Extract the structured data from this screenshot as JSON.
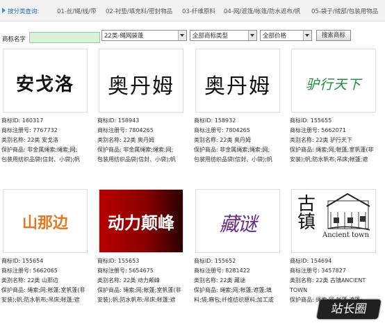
{
  "category_bar": {
    "title": "按分类查询:",
    "categories": [
      "01-丝/绳/线/带",
      "02-衬垫/填充料/密封物品",
      "03-纤维原料",
      "04-网/遮篷/帐篷/防水遮布/帆",
      "05-袋子/绒部/包装用物品"
    ]
  },
  "search": {
    "label": "商标名字",
    "name_value": "",
    "class_select": "22类-绳网袋蓬",
    "type_select": "全部商标类型",
    "price_select": "全部价格",
    "button": "搜索商标"
  },
  "cards": [
    {
      "logo": "安戈洛",
      "id": "商标ID: 160317",
      "reg": "商标注册号: 7767732",
      "cls": "类别名称: 22类   安戈洛",
      "goods": "保护商品: 非金属绳索;绳索;网;",
      "goods2": "包装用纺织品袋(信封、小袋);帆"
    },
    {
      "logo": "奥丹姆",
      "id": "商标ID: 158943",
      "reg": "商标注册号: 7804265",
      "cls": "类别名称: 22类   奥丹姆",
      "goods": "保护商品: 非金属绳索;绳索;网;",
      "goods2": "包装用纺织品袋(信封、小袋);帆"
    },
    {
      "logo": "奥丹姆",
      "id": "商标ID: 158932",
      "reg": "商标注册号: 7804265",
      "cls": "类别名称: 22类   奥丹姆",
      "goods": "保护商品: 非金属绳索;绳索;网;",
      "goods2": "包装用纺织品袋(信封、小袋);帆"
    },
    {
      "logo": "驴行天下",
      "id": "商标ID: 155655",
      "reg": "商标注册号: 5662071",
      "cls": "类别名称: 22类   驴行天下",
      "goods": "保护商品: 绳索;网;帐篷;室帆蓬(非",
      "goods2": "安装);帆;防水帆布;吊床;帐篷;遮"
    },
    {
      "logo": "山那边",
      "id": "商标ID: 155654",
      "reg": "商标注册号: 5662065",
      "cls": "类别名称: 22类   山那边",
      "goods": "保护商品: 绳索;网;帐篷;室帆蓬(非",
      "goods2": "安装);帆;防水帆布;吊床;帐篷;遮"
    },
    {
      "logo": "动力颠峰",
      "id": "商标ID: 155653",
      "reg": "商标注册号: 5654675",
      "cls": "类别名称: 22类   动力颠峰",
      "goods": "保护商品: 绳索;网;帐篷;室帆蓬(非",
      "goods2": "安装);帆;防水帆布;吊床;帐篷;遮"
    },
    {
      "logo": "藏谜",
      "id": "商标ID: 155652",
      "reg": "商标注册号: 8281422",
      "cls": "类别名称: 22类   藏谜",
      "goods": "保护商品: 绳索;网;帐篷;遮篷;填",
      "goods2": "料;袋;麻包;纤维纺织原料;加工或"
    },
    {
      "logo": "古镇",
      "logo_sub": "Ancient town",
      "id": "商标ID: 154694",
      "reg": "商标注册号: 3457827",
      "cls": "类别名称: 22类   古镇ANCIENT",
      "cls2": "TOWN",
      "goods": "保护商品: 绳索;网;帐篷;遮篷;"
    }
  ],
  "watermark": "站长圈",
  "colors": {
    "accent": "#2a72c0",
    "input_green": "#d9f2d9",
    "logo_green": "#1e8a3c",
    "logo_orange": "#e07a22",
    "logo_red": "#c40000",
    "logo_purple": "#6a2b86"
  }
}
